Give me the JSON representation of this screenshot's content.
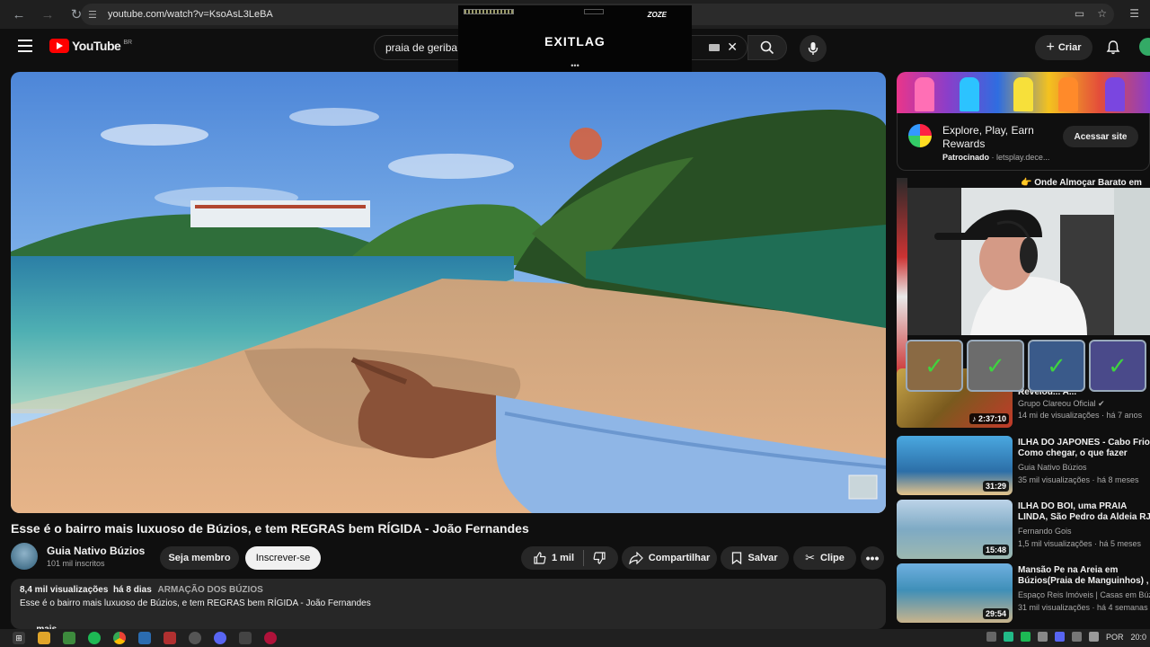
{
  "browser": {
    "url": "youtube.com/watch?v=KsoAsL3LeBA"
  },
  "overlay": {
    "exitlag_logo": "EXITLAG",
    "exitlag_badge": "ZOZE",
    "dots": "•••"
  },
  "header": {
    "logo_text": "YouTube",
    "country_code": "BR",
    "search_query": "praia de geriba",
    "create_label": "Criar"
  },
  "video": {
    "title": "Esse é o bairro mais luxuoso de Búzios, e tem REGRAS bem RÍGIDA - João Fernandes",
    "channel_name": "Guia Nativo Búzios",
    "subscribers": "101 mil inscritos",
    "member_label": "Seja membro",
    "subscribe_label": "Inscrever-se",
    "likes": "1 mil",
    "share_label": "Compartilhar",
    "save_label": "Salvar",
    "clip_label": "Clipe",
    "more_label": "•••"
  },
  "description": {
    "views": "8,4 mil visualizações",
    "age": "há 8 dias",
    "tag": "ARMAÇÃO DOS BÚZIOS",
    "text": "Esse é o bairro mais luxuoso de Búzios, e tem REGRAS bem RÍGIDA - João Fernandes",
    "more": "...mais"
  },
  "ad": {
    "title": "Explore, Play, Earn Rewards",
    "sponsored": "Patrocinado",
    "domain": "letsplay.dece...",
    "cta": "Acessar site"
  },
  "sidebar": {
    "peek_title": "👉 Onde Almoçar Barato em",
    "items": [
      {
        "title1": "Revelou... A...",
        "title2": "",
        "channel": "Grupo Clareou Oficial ✔",
        "stats": "14 mi de visualizações · há 7 anos",
        "duration": "♪ 2:37:10"
      },
      {
        "title1": "ILHA DO JAPONES - Cabo Frio",
        "title2": "Como chegar, o que fazer",
        "channel": "Guia Nativo Búzios",
        "stats": "35 mil visualizações · há 8 meses",
        "duration": "31:29"
      },
      {
        "title1": "ILHA DO BOI, uma PRAIA",
        "title2": "LINDA, São Pedro da Aldeia RJ",
        "channel": "Fernando Gois",
        "stats": "1,5 mil visualizações · há 5 meses",
        "duration": "15:48"
      },
      {
        "title1": "Mansão Pe na Areia em",
        "title2": "Búzios(Praia de Manguinhos) ,",
        "channel": "Espaço Reis Imóveis | Casas em Búz",
        "stats": "31 mil visualizações · há 4 semanas",
        "duration": "29:54"
      }
    ]
  },
  "taskbar": {
    "lang": "POR",
    "time": "20:0"
  },
  "colors": {
    "bg": "#0f0f0f",
    "pill": "#272727",
    "brand_red": "#ff0000"
  }
}
